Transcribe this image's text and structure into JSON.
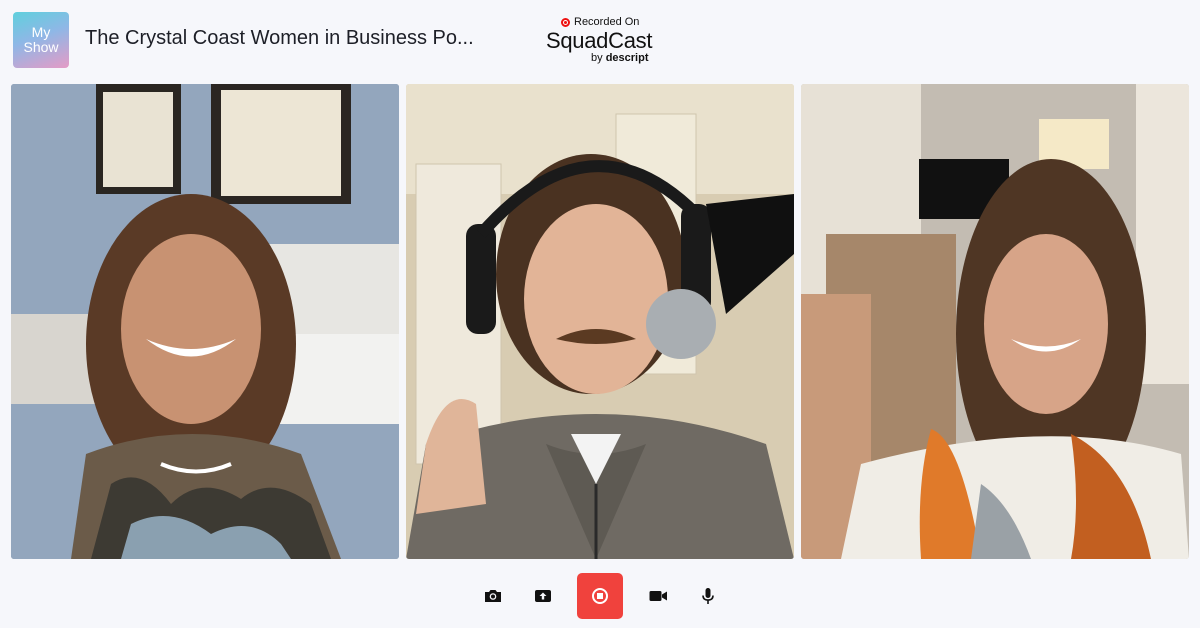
{
  "header": {
    "logo_line1": "My",
    "logo_line2": "Show",
    "title": "The Crystal Coast Women in Business Po...",
    "brand": {
      "recorded_on": "Recorded On",
      "name": "SquadCast",
      "by_prefix": "by",
      "by_name": "descript"
    }
  },
  "participants": [
    {
      "position": "left",
      "description": "woman in camouflage top"
    },
    {
      "position": "center",
      "description": "man with headphones and microphone"
    },
    {
      "position": "right",
      "description": "woman in scarf"
    }
  ],
  "controls": [
    {
      "name": "camera-snapshot-button",
      "icon": "camera-icon"
    },
    {
      "name": "upload-button",
      "icon": "upload-icon"
    },
    {
      "name": "stop-recording-button",
      "icon": "stop-record-icon",
      "color": "#f0423d"
    },
    {
      "name": "video-toggle-button",
      "icon": "video-icon"
    },
    {
      "name": "mic-toggle-button",
      "icon": "microphone-icon"
    }
  ]
}
